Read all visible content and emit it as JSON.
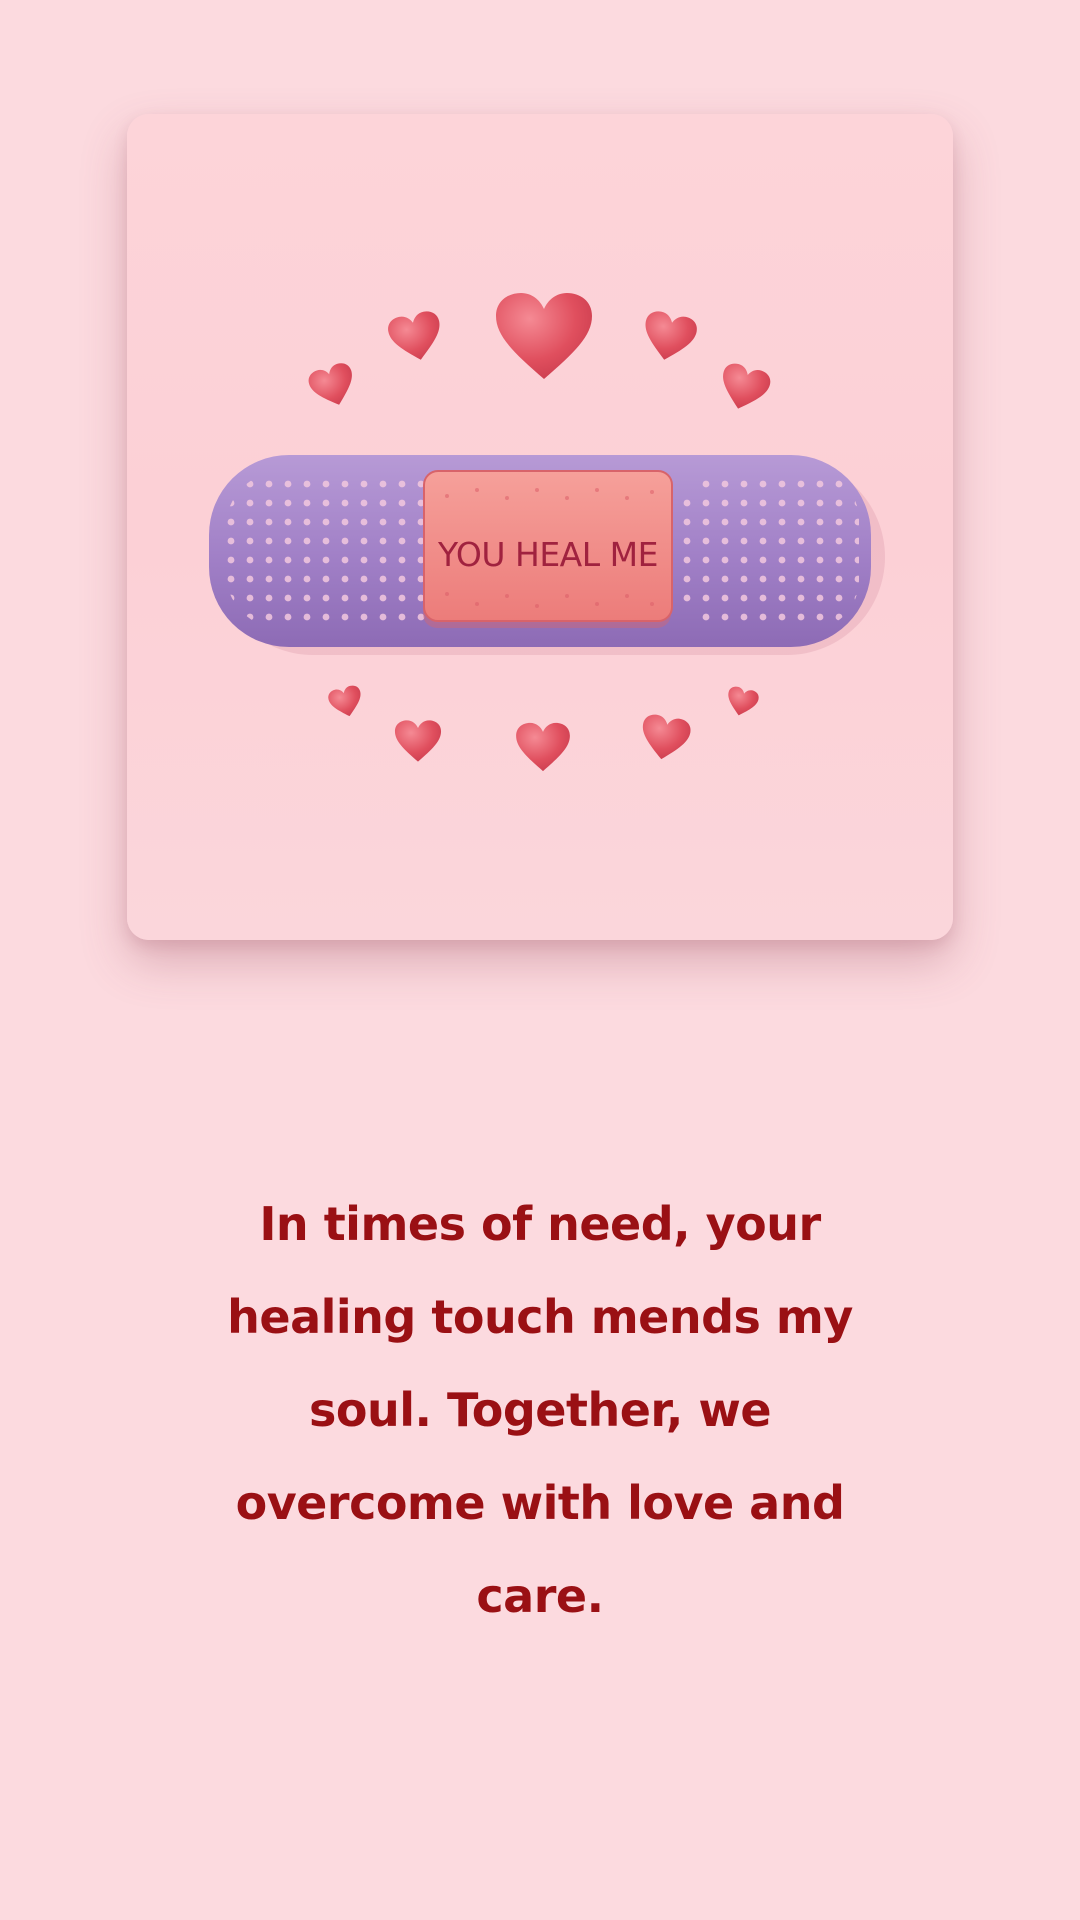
{
  "card": {
    "bandage_text": "YOU HEAL ME"
  },
  "message": {
    "text": "In times of need, your healing touch mends my soul. Together, we overcome with love and care."
  },
  "colors": {
    "background": "#fcdadf",
    "card": "#fcd0d6",
    "bandage": "#a683c9",
    "pad": "#f08a86",
    "heart": "#e8505e",
    "text": "#9a1014"
  }
}
